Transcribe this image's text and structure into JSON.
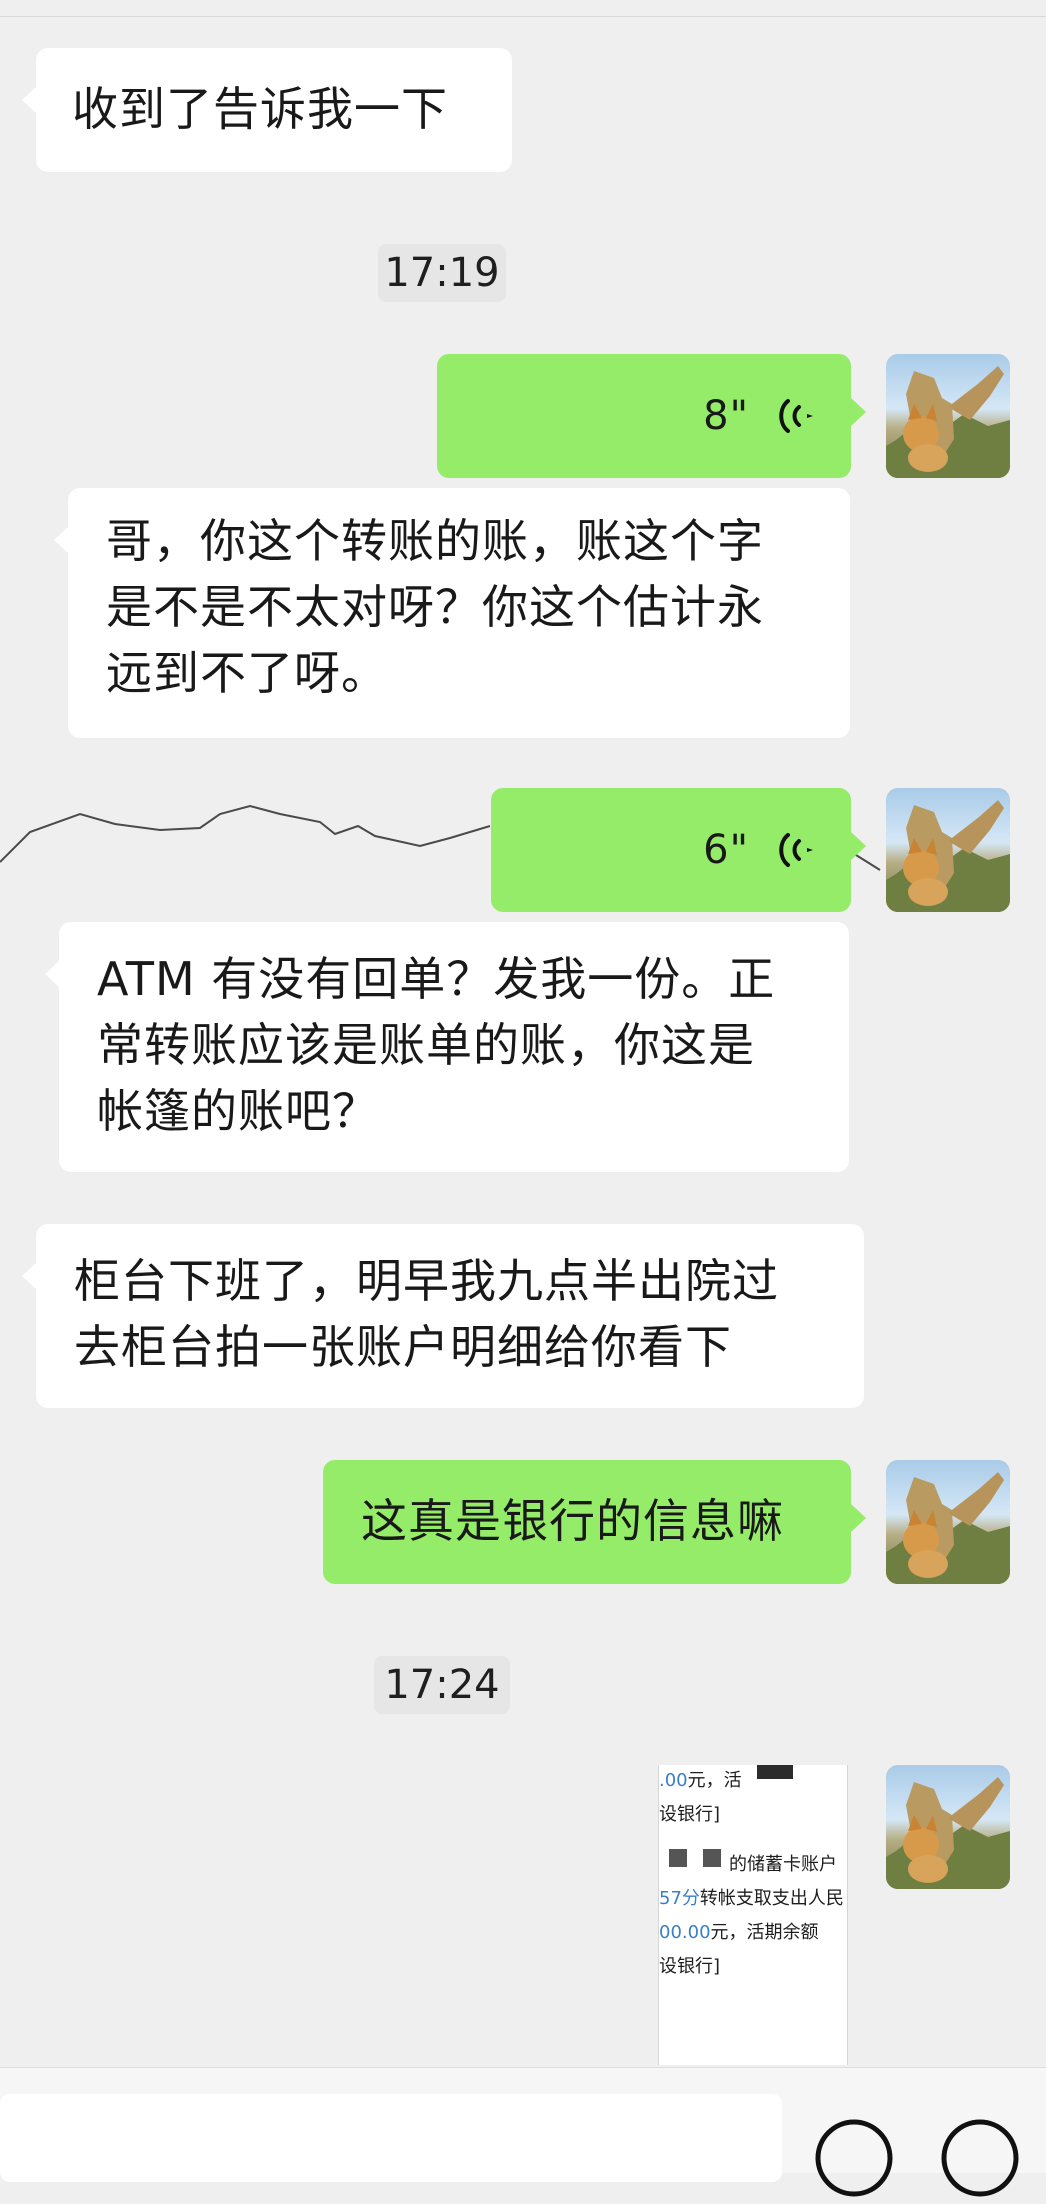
{
  "chat": {
    "messages": [
      {
        "side": "incoming",
        "type": "text",
        "text": "收到了告诉我一下"
      },
      {
        "type": "timestamp",
        "text": "17:19"
      },
      {
        "side": "outgoing",
        "type": "voice",
        "duration": "8\""
      },
      {
        "side": "incoming",
        "type": "text",
        "lines": [
          "哥，你这个转账的账，账这个字",
          "是不是不太对呀？你这个估计永",
          "远到不了呀。"
        ]
      },
      {
        "side": "outgoing",
        "type": "voice",
        "duration": "6\""
      },
      {
        "side": "incoming",
        "type": "text",
        "lines": [
          "ATM 有没有回单？发我一份。正",
          "常转账应该是账单的账，你这是",
          "帐篷的账吧？"
        ]
      },
      {
        "side": "incoming",
        "type": "text",
        "lines": [
          "柜台下班了，明早我九点半出院过",
          "去柜台拍一张账户明细给你看下"
        ]
      },
      {
        "side": "outgoing",
        "type": "text",
        "text": "这真是银行的信息嘛"
      },
      {
        "type": "timestamp",
        "text": "17:24"
      },
      {
        "side": "outgoing",
        "type": "image",
        "preview_lines": [
          "00元，活",
          "设银行]",
          "的储蓄卡账户",
          "57分转帐支取支出人民",
          "00.00元，活期余额",
          "设银行]"
        ]
      }
    ]
  },
  "avatar": {
    "description_icon": "dog-avatar-icon"
  },
  "voice_icon": "voice-wave-icon",
  "colors": {
    "incoming_bubble": "#ffffff",
    "outgoing_bubble": "#95ec69",
    "background": "#efefef",
    "timestamp_bg": "#e6e6e6"
  },
  "input_bar": {
    "icons": [
      "emoji-icon",
      "plus-icon"
    ]
  }
}
